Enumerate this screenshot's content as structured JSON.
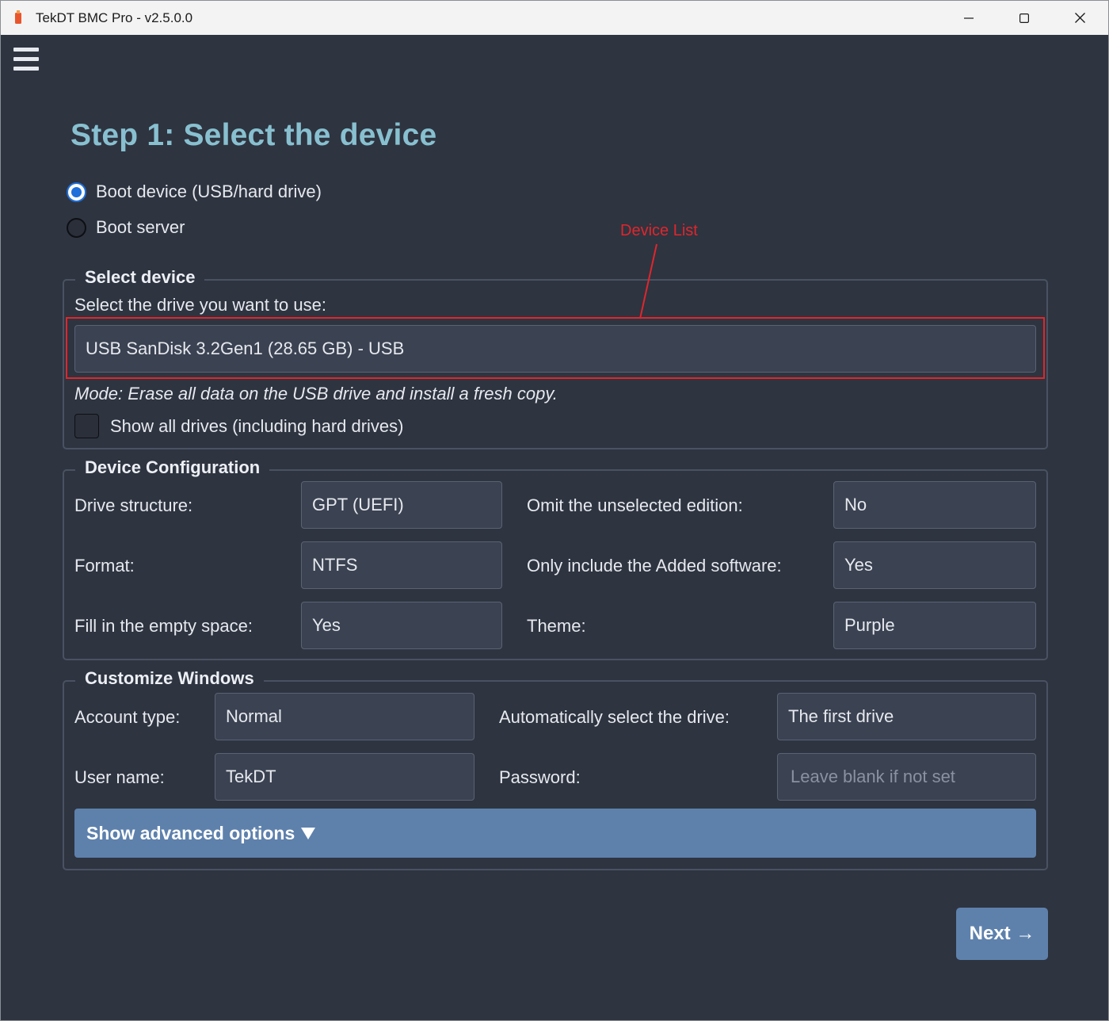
{
  "window": {
    "title": "TekDT BMC Pro - v2.5.0.0",
    "icons": {
      "app": "usb-drive-icon",
      "minimize": "minimize-icon",
      "maximize": "maximize-icon",
      "close": "close-icon"
    }
  },
  "menu": {
    "icon": "hamburger-menu-icon"
  },
  "page": {
    "title": "Step 1: Select the device"
  },
  "mode_options": [
    {
      "label": "Boot device (USB/hard drive)",
      "selected": true
    },
    {
      "label": "Boot server",
      "selected": false
    }
  ],
  "select_device": {
    "legend": "Select device",
    "prompt": "Select the drive you want to use:",
    "selected_drive": "USB SanDisk 3.2Gen1 (28.65 GB) - USB",
    "mode_note": "Mode: Erase all data on the USB drive and install a fresh copy.",
    "show_all_label": "Show all drives (including hard drives)",
    "show_all_checked": false
  },
  "annotation": {
    "text": "Device List",
    "color": "#e0262c"
  },
  "device_config": {
    "legend": "Device Configuration",
    "drive_structure": {
      "label": "Drive structure:",
      "value": "GPT (UEFI)"
    },
    "format": {
      "label": "Format:",
      "value": "NTFS"
    },
    "fill_empty": {
      "label": "Fill in the empty space:",
      "value": "Yes"
    },
    "omit_edition": {
      "label": "Omit the unselected edition:",
      "value": "No"
    },
    "only_added": {
      "label": "Only include the Added software:",
      "value": "Yes"
    },
    "theme": {
      "label": "Theme:",
      "value": "Purple"
    }
  },
  "customize": {
    "legend": "Customize Windows",
    "account_type": {
      "label": "Account type:",
      "value": "Normal"
    },
    "user_name": {
      "label": "User name:",
      "value": "TekDT"
    },
    "auto_select": {
      "label": "Automatically select the drive:",
      "value": "The first drive"
    },
    "password": {
      "label": "Password:",
      "placeholder": "Leave blank if not set"
    },
    "advanced_button": "Show advanced options"
  },
  "next_button": "Next →",
  "colors": {
    "background": "#2e3440",
    "title_accent": "#88c0d0",
    "button": "#5e81ac",
    "field": "#3b4252",
    "radio_selected": "#1e6fd9"
  }
}
